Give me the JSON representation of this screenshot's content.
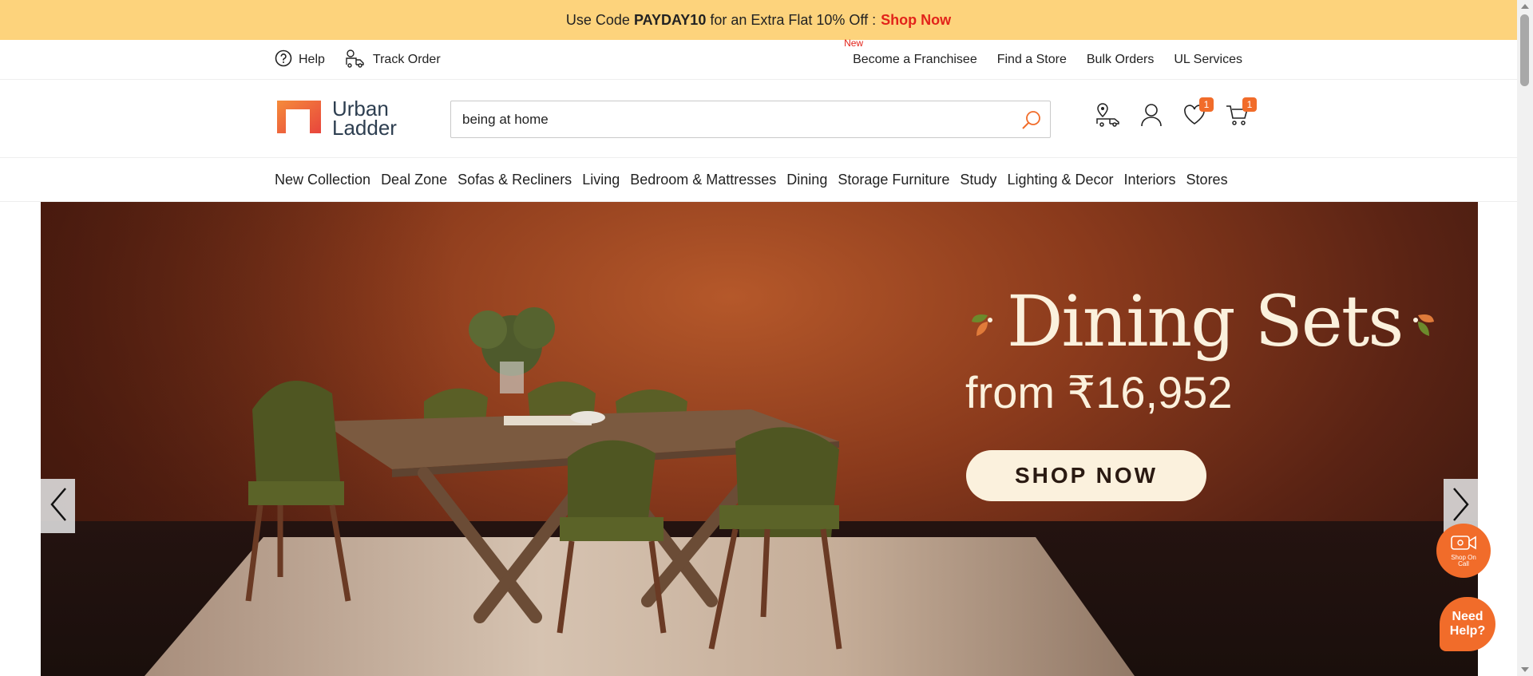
{
  "promo": {
    "prefix": "Use Code",
    "code": "PAYDAY10",
    "middle": "for an Extra Flat 10% Off :",
    "cta": "Shop Now"
  },
  "util": {
    "left": [
      {
        "label": "Help",
        "icon": "help-circle-icon"
      },
      {
        "label": "Track Order",
        "icon": "delivery-truck-icon"
      }
    ],
    "right": [
      {
        "label": "Become a Franchisee",
        "tag": "New"
      },
      {
        "label": "Find a Store"
      },
      {
        "label": "Bulk Orders"
      },
      {
        "label": "UL Services"
      }
    ]
  },
  "header": {
    "logo_line1": "Urban",
    "logo_line2": "Ladder",
    "search_value": "being at home",
    "wishlist_count": "1",
    "cart_count": "1"
  },
  "nav": [
    "New Collection",
    "Deal Zone",
    "Sofas & Recliners",
    "Living",
    "Bedroom & Mattresses",
    "Dining",
    "Storage Furniture",
    "Study",
    "Lighting & Decor",
    "Interiors",
    "Stores"
  ],
  "hero": {
    "title": "Dining Sets",
    "subtitle": "from ₹16,952",
    "cta": "SHOP NOW"
  },
  "widgets": {
    "call_label": "Shop On Call",
    "help_label": "Need Help?"
  },
  "colors": {
    "promo_bg": "#fdd37c",
    "accent": "#f16c2a",
    "cta_red": "#e2231a"
  }
}
